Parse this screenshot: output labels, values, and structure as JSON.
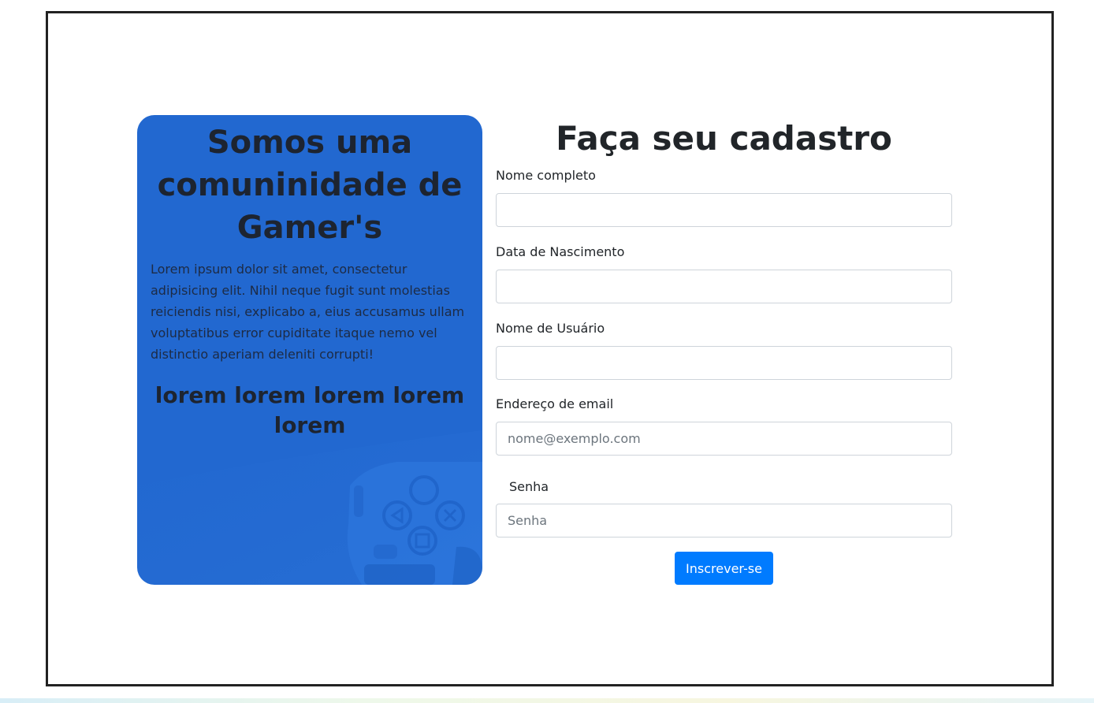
{
  "promo": {
    "title": "Somos uma comuninidade de Gamer's",
    "text": "Lorem ipsum dolor sit amet, consectetur adipisicing elit. Nihil neque fugit sunt molestias reiciendis nisi, explicabo a, eius accusamus ullam voluptatibus error cupiditate itaque nemo vel distinctio aperiam deleniti corrupti!",
    "subtitle": "lorem lorem lorem lorem lorem",
    "background_color": "#2268d0",
    "image_icon": "game-controller-icon"
  },
  "form": {
    "title": "Faça seu cadastro",
    "fields": [
      {
        "label": "Nome completo",
        "value": "",
        "placeholder": ""
      },
      {
        "label": "Data de Nascimento",
        "value": "",
        "placeholder": ""
      },
      {
        "label": "Nome de Usuário",
        "value": "",
        "placeholder": ""
      },
      {
        "label": "Endereço de email",
        "value": "",
        "placeholder": "nome@exemplo.com"
      },
      {
        "label": "Senha",
        "value": "",
        "placeholder": "Senha"
      }
    ],
    "submit_label": "Inscrever-se",
    "submit_color": "#007bff"
  }
}
